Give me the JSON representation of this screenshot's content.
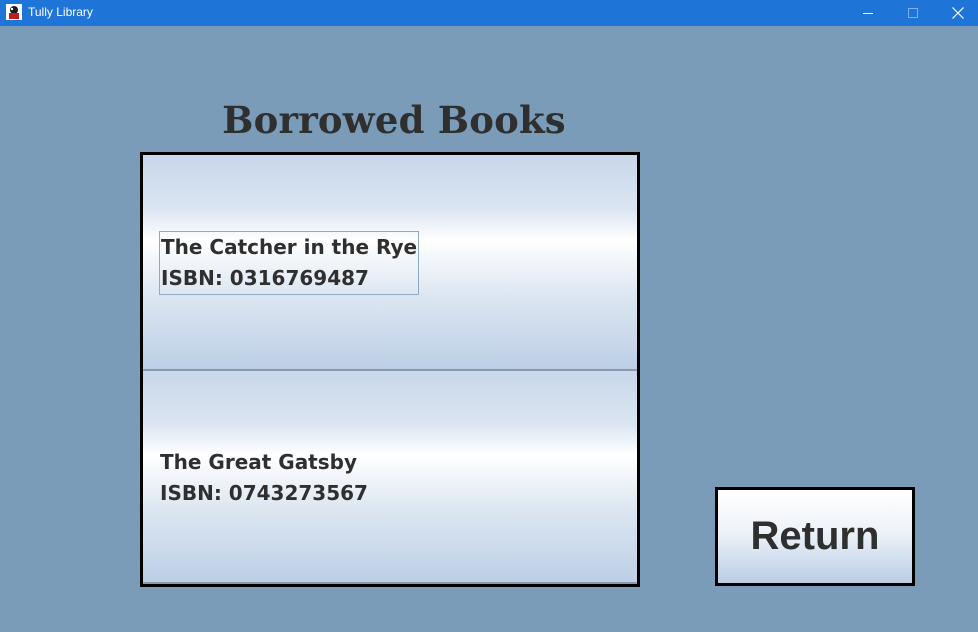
{
  "window": {
    "title": "Tully Library",
    "icon": "library-app-icon",
    "controls": [
      "minimize-icon",
      "maximize-icon",
      "close-icon"
    ]
  },
  "page": {
    "heading": "Borrowed Books"
  },
  "books": [
    {
      "title": "The Catcher in the Rye",
      "isbn": "ISBN: 0316769487",
      "selected": true
    },
    {
      "title": "The Great Gatsby",
      "isbn": "ISBN: 0743273567",
      "selected": false
    }
  ],
  "actions": {
    "return_label": "Return"
  },
  "colors": {
    "titlebar": "#1f74d8",
    "background": "#7a9cb9",
    "text": "#2f2f2f"
  }
}
